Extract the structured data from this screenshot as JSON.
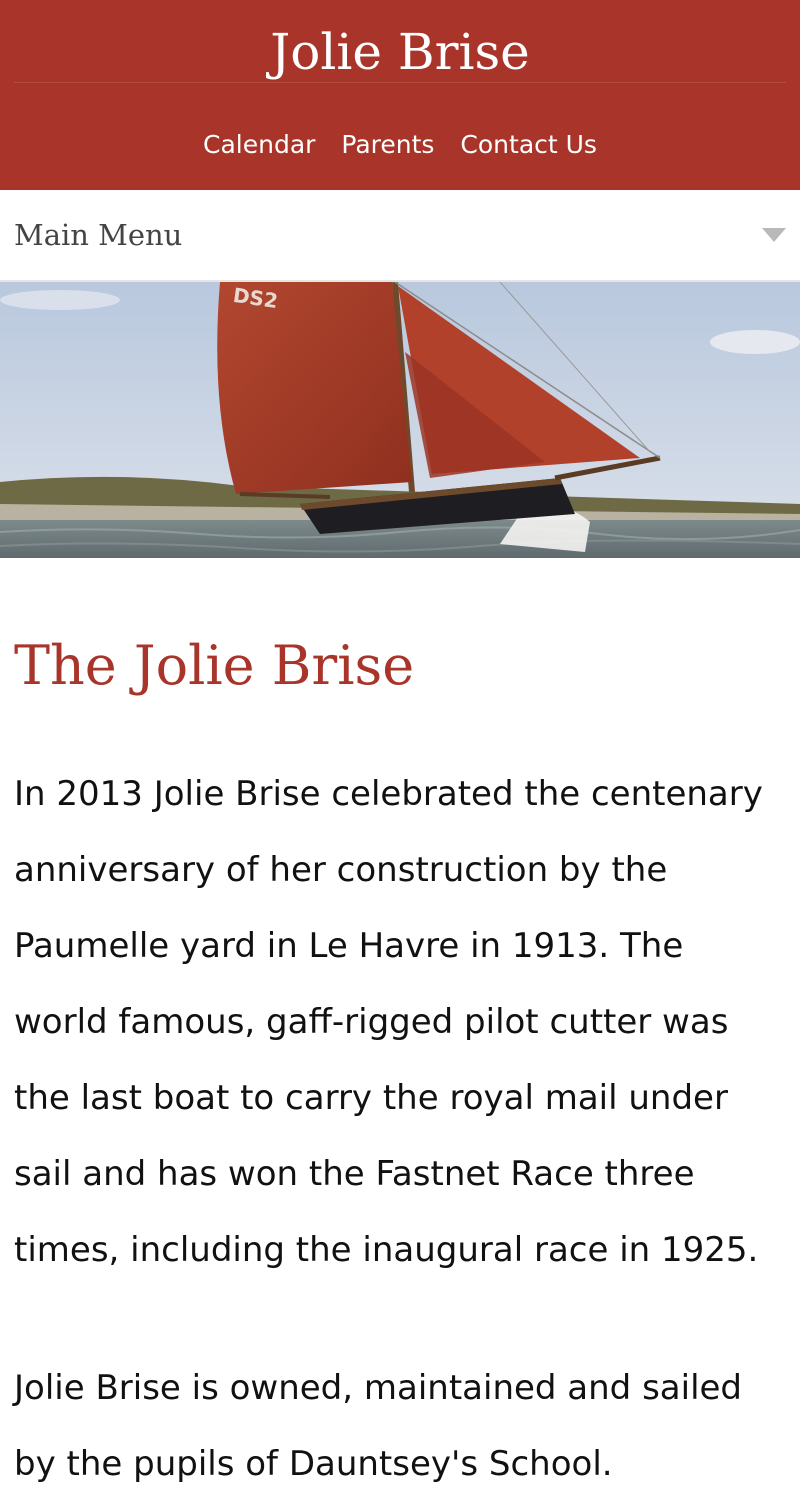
{
  "header": {
    "site_title": "Jolie Brise",
    "nav": {
      "calendar": "Calendar",
      "parents": "Parents",
      "contact": "Contact Us"
    }
  },
  "menu": {
    "label": "Main Menu",
    "toggle_icon": "chevron-down-icon"
  },
  "hero": {
    "sail_number": "DS2"
  },
  "main": {
    "title": "The Jolie Brise",
    "paragraphs": [
      "In 2013 Jolie Brise celebrated the centenary anniversary of her construction by the Paumelle yard in Le Havre in 1913. The world famous, gaff-rigged pilot cutter was the last boat to carry the royal mail under sail and has won the Fastnet Race three times, including the inaugural race in 1925.",
      "Jolie Brise is owned, maintained and sailed by the pupils of Dauntsey's School."
    ]
  },
  "colors": {
    "brand": "#a8342a",
    "menu_text": "#444444",
    "body_text": "#111111"
  }
}
